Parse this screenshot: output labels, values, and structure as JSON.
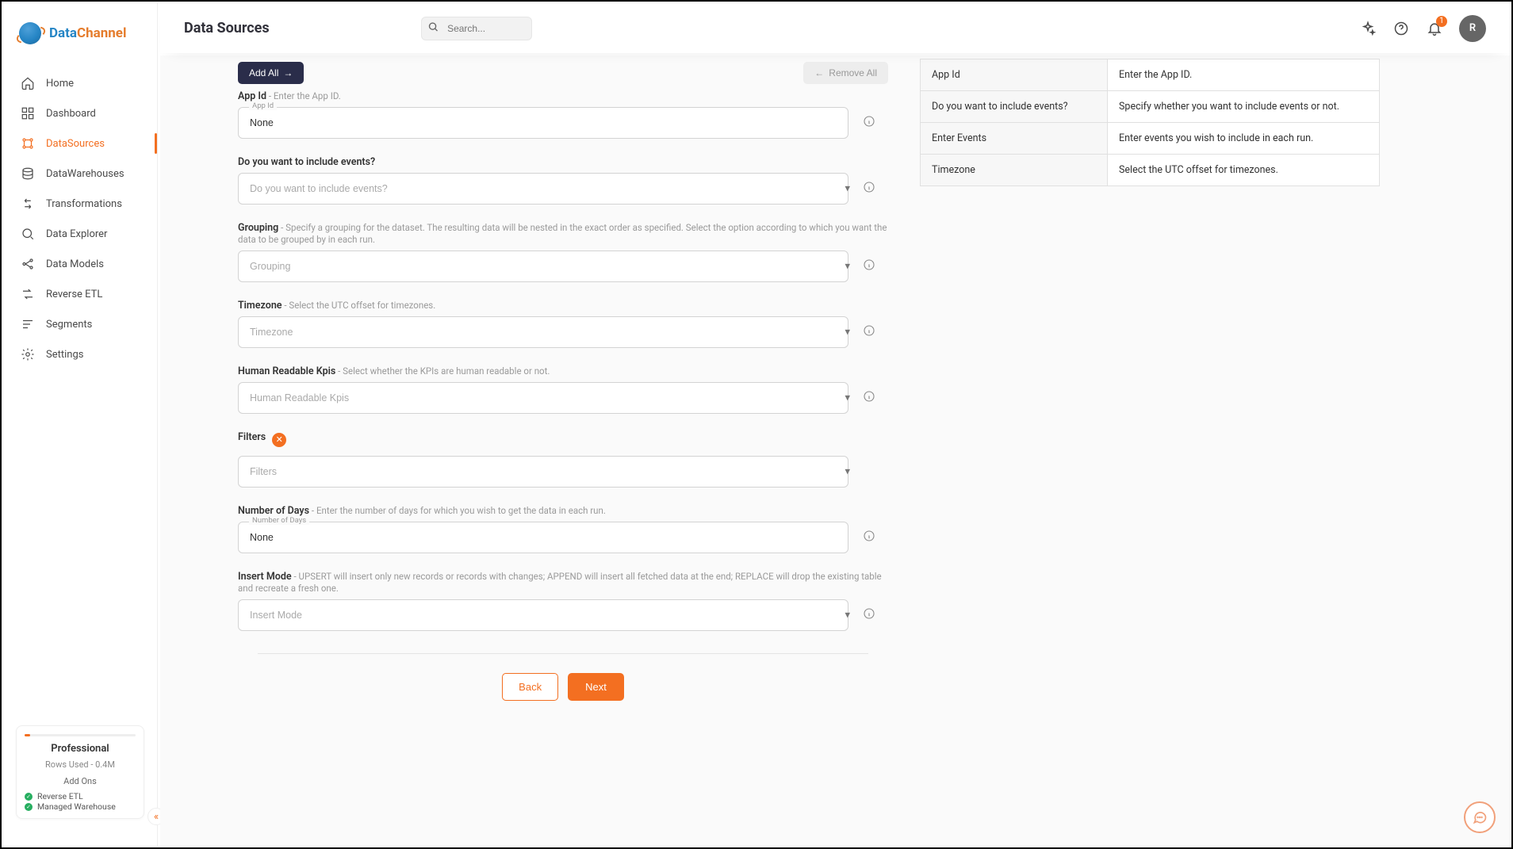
{
  "brand": {
    "part1": "Data",
    "part2": "Channel"
  },
  "header": {
    "title": "Data Sources",
    "search_placeholder": "Search...",
    "notification_count": "1",
    "avatar_initial": "R"
  },
  "sidebar": {
    "items": [
      {
        "label": "Home"
      },
      {
        "label": "Dashboard"
      },
      {
        "label": "DataSources"
      },
      {
        "label": "DataWarehouses"
      },
      {
        "label": "Transformations"
      },
      {
        "label": "Data Explorer"
      },
      {
        "label": "Data Models"
      },
      {
        "label": "Reverse ETL"
      },
      {
        "label": "Segments"
      },
      {
        "label": "Settings"
      }
    ],
    "plan": {
      "name": "Professional",
      "rows_used": "Rows Used - 0.4M",
      "addons_label": "Add Ons",
      "addons": [
        "Reverse ETL",
        "Managed Warehouse"
      ]
    }
  },
  "toolbar": {
    "add_all": "Add All",
    "remove_all": "Remove All"
  },
  "form": {
    "app_id": {
      "label": "App Id",
      "desc": " - Enter the App ID.",
      "float": "App Id",
      "value": "None"
    },
    "include_events": {
      "label": "Do you want to include events?",
      "placeholder": "Do you want to include events?"
    },
    "grouping": {
      "label": "Grouping",
      "desc": " - Specify a grouping for the dataset. The resulting data will be nested in the exact order as specified. Select the option according to which you want the data to be grouped by in each run.",
      "placeholder": "Grouping"
    },
    "timezone": {
      "label": "Timezone",
      "desc": " - Select the UTC offset for timezones.",
      "placeholder": "Timezone"
    },
    "kpis": {
      "label": "Human Readable Kpis",
      "desc": " - Select whether the KPIs are human readable or not.",
      "placeholder": "Human Readable Kpis"
    },
    "filters": {
      "label": "Filters",
      "placeholder": "Filters"
    },
    "num_days": {
      "label": "Number of Days",
      "desc": " - Enter the number of days for which you wish to get the data in each run.",
      "float": "Number of Days",
      "value": "None"
    },
    "insert_mode": {
      "label": "Insert Mode",
      "desc": " - UPSERT will insert only new records or records with changes; APPEND will insert all fetched data at the end; REPLACE will drop the existing table and recreate a fresh one.",
      "placeholder": "Insert Mode"
    }
  },
  "footer": {
    "back": "Back",
    "next": "Next"
  },
  "side_table": [
    {
      "k": "App Id",
      "v": "Enter the App ID."
    },
    {
      "k": "Do you want to include events?",
      "v": "Specify whether you want to include events or not."
    },
    {
      "k": "Enter Events",
      "v": "Enter events you wish to include in each run."
    },
    {
      "k": "Timezone",
      "v": "Select the UTC offset for timezones."
    }
  ]
}
